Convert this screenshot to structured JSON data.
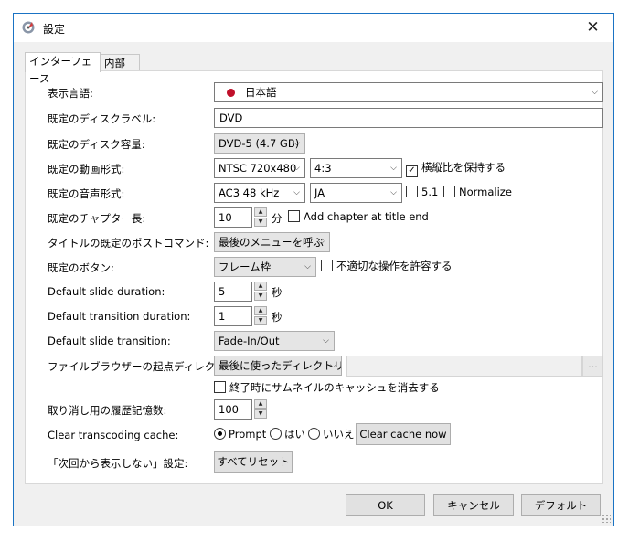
{
  "window": {
    "title": "設定",
    "close": "✕"
  },
  "tabs": [
    {
      "label": "インターフェース"
    },
    {
      "label": "内部"
    }
  ],
  "form": {
    "language": {
      "label": "表示言語:",
      "value": "日本語"
    },
    "disc_label": {
      "label": "既定のディスクラベル:",
      "value": "DVD"
    },
    "disc_capacity": {
      "label": "既定のディスク容量:",
      "value": "DVD-5 (4.7 GB)"
    },
    "video_format": {
      "label": "既定の動画形式:",
      "standard": "NTSC 720x480",
      "aspect": "4:3",
      "keep_aspect": "横縦比を保持する",
      "keep_aspect_checked": true
    },
    "audio_format": {
      "label": "既定の音声形式:",
      "codec": "AC3 48 kHz",
      "language": "JA",
      "surround": "5.1",
      "normalize": "Normalize"
    },
    "chapter": {
      "label": "既定のチャプター長:",
      "value": "10",
      "unit": "分",
      "add_at_end": "Add chapter at title end"
    },
    "post_command": {
      "label": "タイトルの既定のポストコマンド:",
      "value": "最後のメニューを呼ぶ"
    },
    "button": {
      "label": "既定のボタン:",
      "value": "フレーム枠",
      "allow_bad_ops": "不適切な操作を許容する"
    },
    "slide_duration": {
      "label": "Default slide duration:",
      "value": "5",
      "unit": "秒"
    },
    "transition_duration": {
      "label": "Default transition duration:",
      "value": "1",
      "unit": "秒"
    },
    "slide_transition": {
      "label": "Default slide transition:",
      "value": "Fade-In/Out"
    },
    "browser_start": {
      "label": "ファイルブラウザーの起点ディレクトリ:",
      "value": "最後に使ったディレクトリ",
      "browse": "...",
      "clear_thumbs": "終了時にサムネイルのキャッシュを消去する"
    },
    "undo_history": {
      "label": "取り消し用の履歴記憶数:",
      "value": "100"
    },
    "transcode_cache": {
      "label": "Clear transcoding cache:",
      "prompt": "Prompt",
      "yes": "はい",
      "no": "いいえ",
      "clear_now": "Clear cache now"
    },
    "dont_show": {
      "label": "「次回から表示しない」設定:",
      "reset": "すべてリセット"
    }
  },
  "footer": {
    "ok": "OK",
    "cancel": "キャンセル",
    "default": "デフォルト"
  },
  "colors": {
    "window_border": "#1a73c4",
    "flag": "#c0102a"
  }
}
